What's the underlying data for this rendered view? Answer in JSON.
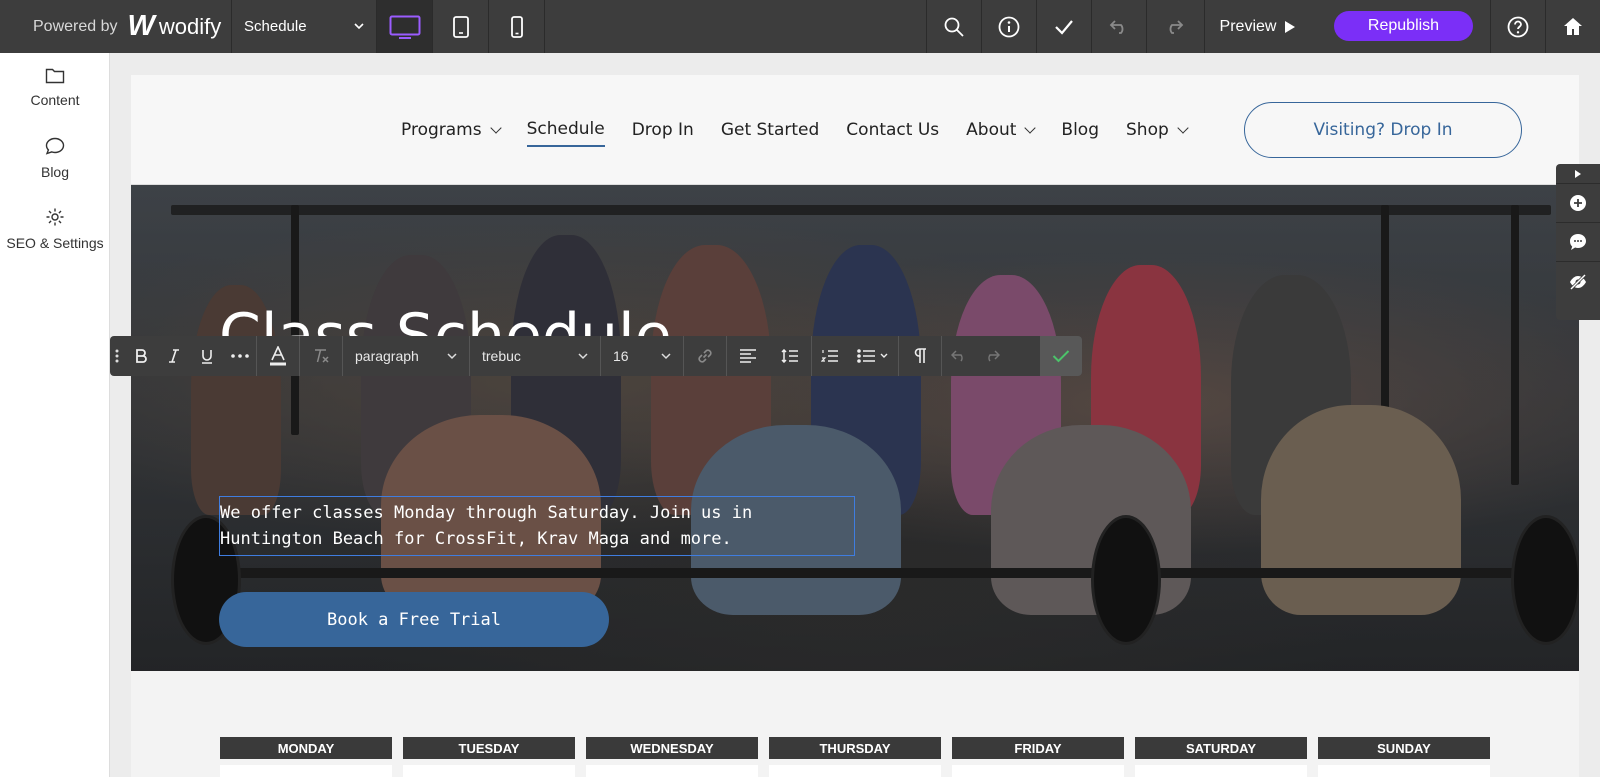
{
  "topbar": {
    "powered_by": "Powered by",
    "brand_mark": "W",
    "brand_name": "wodify",
    "page_select": "Schedule",
    "preview_label": "Preview",
    "republish_label": "Republish",
    "accent_color": "#7b2ff7"
  },
  "sidebar": {
    "items": [
      {
        "label": "Content",
        "icon": "folder-icon"
      },
      {
        "label": "Blog",
        "icon": "chat-bubble-icon"
      },
      {
        "label": "SEO & Settings",
        "icon": "gear-icon"
      }
    ]
  },
  "site": {
    "nav": [
      "Programs",
      "Schedule",
      "Drop In",
      "Get Started",
      "Contact Us",
      "About",
      "Blog",
      "Shop"
    ],
    "nav_active": "Schedule",
    "drop_in_button": "Visiting? Drop In",
    "hero_title": "Class Schedule",
    "hero_text": "We offer classes Monday through Saturday. Join us in Huntington Beach for CrossFit, Krav Maga and more.",
    "hero_button": "Book a Free Trial",
    "brand_color": "#37669a",
    "days": [
      "MONDAY",
      "TUESDAY",
      "WEDNESDAY",
      "THURSDAY",
      "FRIDAY",
      "SATURDAY",
      "SUNDAY"
    ]
  },
  "editor_toolbar": {
    "block_format": "paragraph",
    "font_family": "trebuc",
    "font_size": "16"
  }
}
